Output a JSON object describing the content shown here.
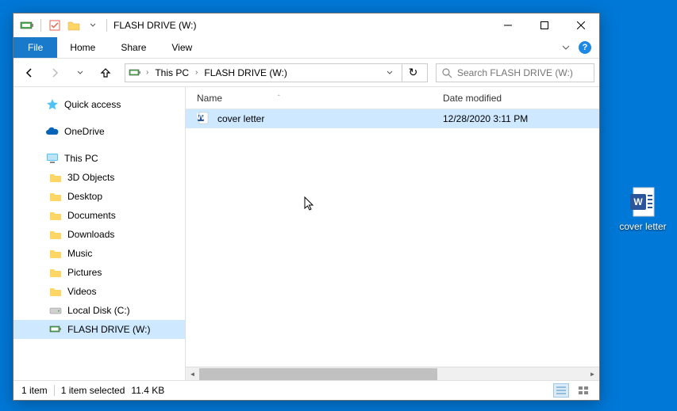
{
  "window": {
    "title": "FLASH DRIVE (W:)"
  },
  "ribbon": {
    "file": "File",
    "tabs": [
      "Home",
      "Share",
      "View"
    ]
  },
  "breadcrumb": {
    "segments": [
      "This PC",
      "FLASH DRIVE (W:)"
    ]
  },
  "search": {
    "placeholder": "Search FLASH DRIVE (W:)"
  },
  "nav_items": {
    "quick_access": "Quick access",
    "onedrive": "OneDrive",
    "this_pc": "This PC",
    "objects3d": "3D Objects",
    "desktop": "Desktop",
    "documents": "Documents",
    "downloads": "Downloads",
    "music": "Music",
    "pictures": "Pictures",
    "videos": "Videos",
    "local_disk": "Local Disk (C:)",
    "flash_drive": "FLASH DRIVE (W:)"
  },
  "columns": {
    "name": "Name",
    "date": "Date modified"
  },
  "files": [
    {
      "name": "cover letter",
      "date": "12/28/2020 3:11 PM"
    }
  ],
  "status": {
    "count": "1 item",
    "selected": "1 item selected",
    "size": "11.4 KB"
  },
  "desktop": {
    "cover_letter": "cover letter"
  }
}
